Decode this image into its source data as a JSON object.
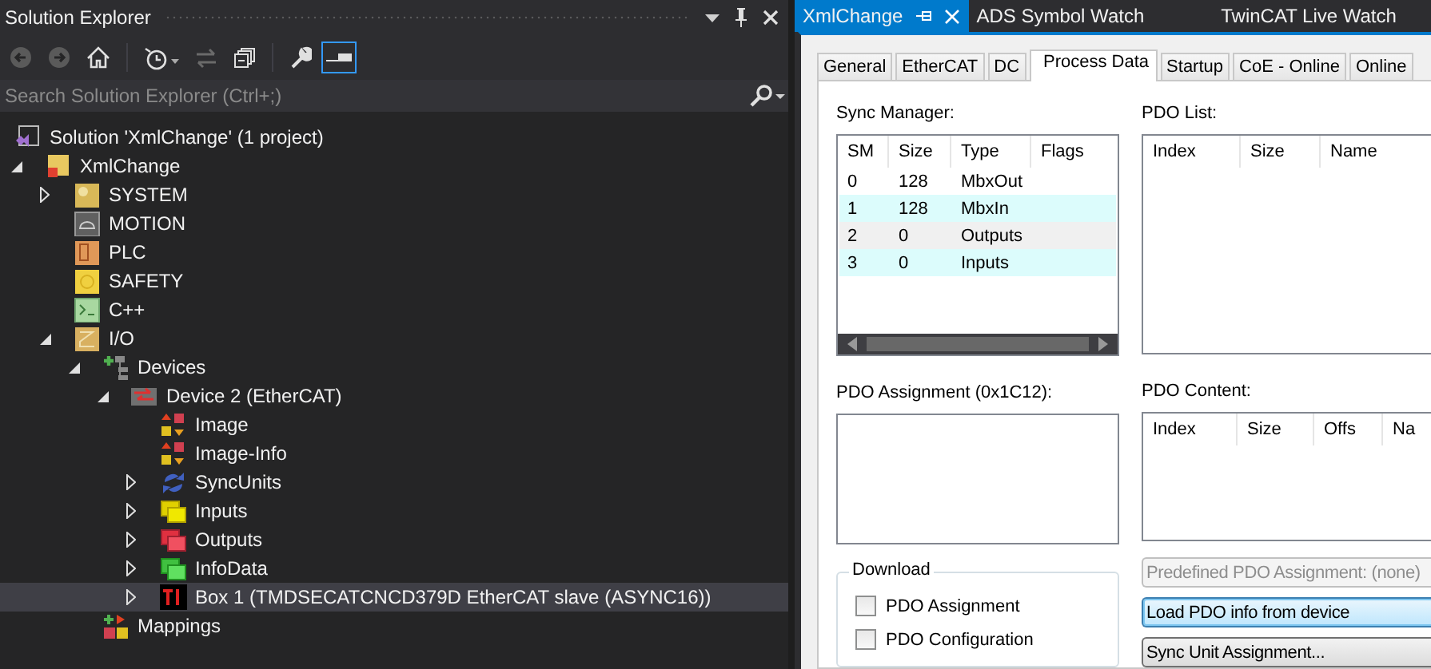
{
  "solution_explorer": {
    "title": "Solution Explorer",
    "search": {
      "placeholder": "Search Solution Explorer (Ctrl+;)"
    },
    "tree": [
      {
        "label": "Solution 'XmlChange' (1 project)",
        "kind": "solution",
        "selected": false,
        "children": [
          {
            "label": "XmlChange",
            "kind": "project",
            "expanded": true,
            "selected": false,
            "children": [
              {
                "label": "SYSTEM",
                "kind": "system",
                "expanded": false,
                "selected": false
              },
              {
                "label": "MOTION",
                "kind": "motion",
                "selected": false
              },
              {
                "label": "PLC",
                "kind": "plc",
                "selected": false
              },
              {
                "label": "SAFETY",
                "kind": "safety",
                "selected": false
              },
              {
                "label": "C++",
                "kind": "cpp",
                "selected": false
              },
              {
                "label": "I/O",
                "kind": "io",
                "expanded": true,
                "selected": false,
                "children": [
                  {
                    "label": "Devices",
                    "kind": "devices",
                    "expanded": true,
                    "selected": false,
                    "children": [
                      {
                        "label": "Device 2 (EtherCAT)",
                        "kind": "device",
                        "expanded": true,
                        "selected": false,
                        "children": [
                          {
                            "label": "Image",
                            "kind": "image",
                            "selected": false
                          },
                          {
                            "label": "Image-Info",
                            "kind": "image",
                            "selected": false
                          },
                          {
                            "label": "SyncUnits",
                            "kind": "sync",
                            "expanded": false,
                            "selected": false
                          },
                          {
                            "label": "Inputs",
                            "kind": "inputs",
                            "expanded": false,
                            "selected": false
                          },
                          {
                            "label": "Outputs",
                            "kind": "outputs",
                            "expanded": false,
                            "selected": false
                          },
                          {
                            "label": "InfoData",
                            "kind": "infodata",
                            "expanded": false,
                            "selected": false
                          },
                          {
                            "label": "Box 1 (TMDSECATCNCD379D EtherCAT slave (ASYNC16))",
                            "kind": "box",
                            "expanded": false,
                            "selected": true
                          }
                        ]
                      }
                    ]
                  },
                  {
                    "label": "Mappings",
                    "kind": "mappings",
                    "selected": false
                  }
                ]
              }
            ]
          }
        ]
      }
    ]
  },
  "document_tabs": [
    {
      "label": "XmlChange",
      "selected": true
    },
    {
      "label": "ADS Symbol Watch",
      "selected": false
    },
    {
      "label": "TwinCAT Live Watch",
      "selected": false
    }
  ],
  "property_tabs": [
    {
      "label": "General",
      "selected": false
    },
    {
      "label": "EtherCAT",
      "selected": false
    },
    {
      "label": "DC",
      "selected": false
    },
    {
      "label": "Process Data",
      "selected": true
    },
    {
      "label": "Startup",
      "selected": false
    },
    {
      "label": "CoE - Online",
      "selected": false
    },
    {
      "label": "Online",
      "selected": false
    }
  ],
  "sync_manager": {
    "label": "Sync Manager:",
    "columns": [
      "SM",
      "Size",
      "Type",
      "Flags"
    ],
    "rows": [
      {
        "cells": [
          "0",
          "128",
          "MbxOut"
        ],
        "color": "#ffffff"
      },
      {
        "cells": [
          "1",
          "128",
          "MbxIn"
        ],
        "color": "#dcfcfc"
      },
      {
        "cells": [
          "2",
          "0",
          "Outputs"
        ],
        "color": "#f0f0f0"
      },
      {
        "cells": [
          "3",
          "0",
          "Inputs"
        ],
        "color": "#dcfcfc"
      }
    ]
  },
  "pdo_list": {
    "label": "PDO List:",
    "columns": [
      "Index",
      "Size",
      "Name"
    ]
  },
  "pdo_assignment": {
    "label": "PDO Assignment (0x1C12):"
  },
  "pdo_content": {
    "label": "PDO Content:",
    "columns": [
      "Index",
      "Size",
      "Offs",
      "Na"
    ]
  },
  "download": {
    "title": "Download",
    "options": [
      {
        "label": "PDO Assignment",
        "checked": false
      },
      {
        "label": "PDO Configuration",
        "checked": false
      }
    ]
  },
  "buttons": [
    {
      "label": "Predefined PDO Assignment: (none)",
      "disabled": true,
      "focused": false
    },
    {
      "label": "Load PDO info from device",
      "disabled": false,
      "focused": true
    },
    {
      "label": "Sync Unit Assignment...",
      "disabled": false,
      "focused": false
    }
  ]
}
